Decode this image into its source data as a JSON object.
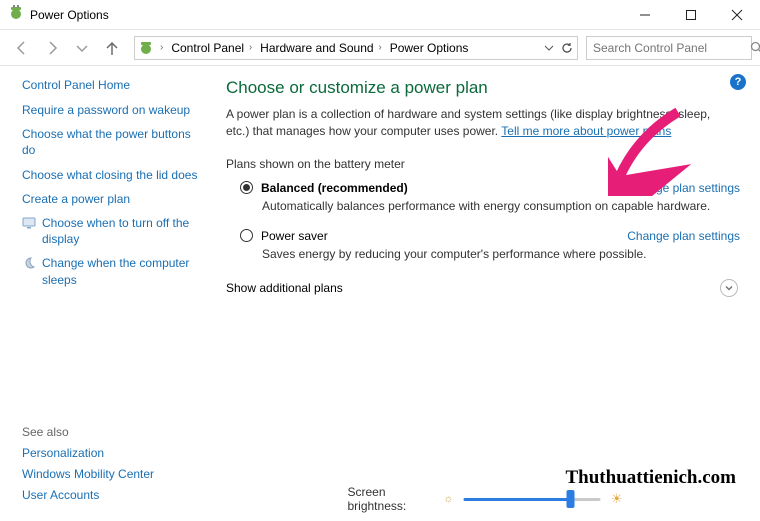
{
  "window": {
    "title": "Power Options"
  },
  "nav": {
    "breadcrumbs": [
      "Control Panel",
      "Hardware and Sound",
      "Power Options"
    ],
    "search_placeholder": "Search Control Panel"
  },
  "sidebar": {
    "home": "Control Panel Home",
    "links": [
      "Require a password on wakeup",
      "Choose what the power buttons do",
      "Choose what closing the lid does",
      "Create a power plan",
      "Choose when to turn off the display",
      "Change when the computer sleeps"
    ],
    "see_also_head": "See also",
    "see_also": [
      "Personalization",
      "Windows Mobility Center",
      "User Accounts"
    ]
  },
  "main": {
    "title": "Choose or customize a power plan",
    "intro_pre": "A power plan is a collection of hardware and system settings (like display brightness, sleep, etc.) that manages how your computer uses power. ",
    "intro_link": "Tell me more about power plans",
    "section_head": "Plans shown on the battery meter",
    "plans": [
      {
        "name": "Balanced (recommended)",
        "checked": true,
        "desc": "Automatically balances performance with energy consumption on capable hardware.",
        "change": "Change plan settings"
      },
      {
        "name": "Power saver",
        "checked": false,
        "desc": "Saves energy by reducing your computer's performance where possible.",
        "change": "Change plan settings"
      }
    ],
    "show_additional": "Show additional plans",
    "brightness_label": "Screen brightness:"
  },
  "watermark": "Thuthuattienich.com"
}
